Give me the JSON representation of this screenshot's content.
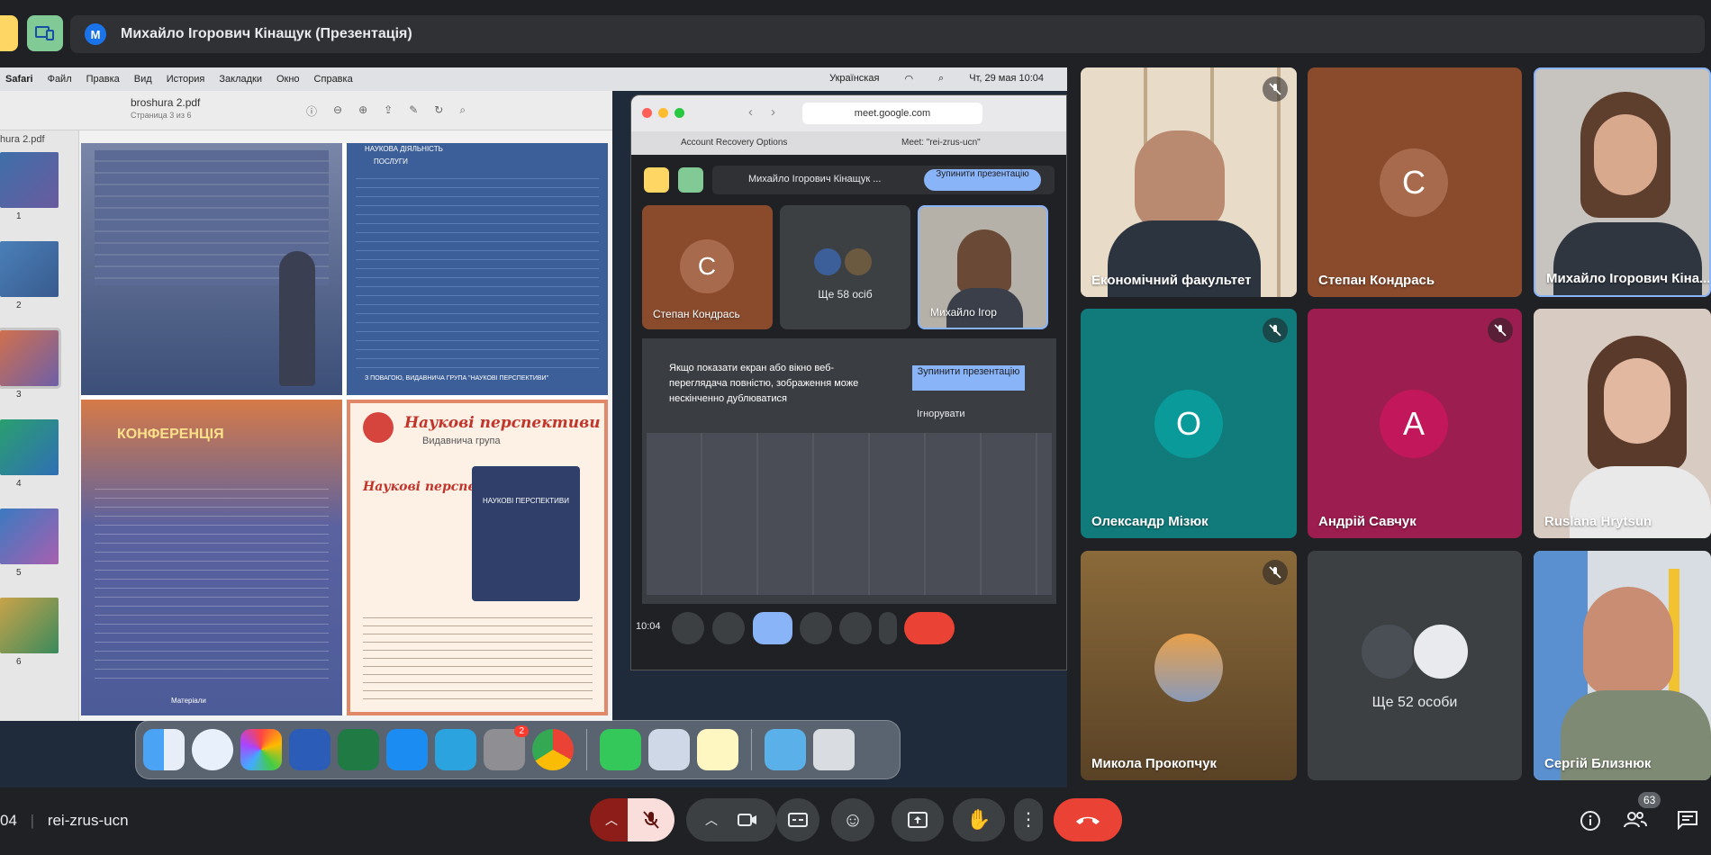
{
  "top": {
    "presenter_initial": "M",
    "presenter_title": "Михайло Ігорович Кінащук (Презентація)"
  },
  "mac": {
    "menu": [
      "Safari",
      "Файл",
      "Правка",
      "Вид",
      "История",
      "Закладки",
      "Окно",
      "Справка"
    ],
    "keyboard": "Українская",
    "datetime": "Чт, 29 мая  10:04"
  },
  "preview": {
    "file": "broshura 2.pdf",
    "page_info": "Страница 3 из 6",
    "side_file": "hura 2.pdf",
    "thumbs": [
      "1",
      "2",
      "3",
      "4",
      "5",
      "6"
    ],
    "page_title": "Наукові перспективи",
    "page_subtitle": "Видавнича група",
    "brochure_quote": "Наукові перспективи",
    "conf_title": "КОНФЕРЕНЦІЯ",
    "book_title": "НАУКОВІ ПЕРСПЕКТИВИ",
    "footer_text": "З ПОВАГОЮ, ВИДАВНИЧА ГРУПА \"НАУКОВІ ПЕРСПЕКТИВИ\"",
    "header_text": "НАУКОВА ДІЯЛЬНІСТЬ",
    "posluhy": "ПОСЛУГИ",
    "materials": "Матеріали"
  },
  "browser": {
    "url": "meet.google.com",
    "tab1": "Account Recovery Options",
    "tab2": "Meet: \"rei-zrus-ucn\"",
    "presenter": "Михайло Ігорович Кінащук ...",
    "stop_btn": "Зупинити презентацію",
    "tile1_initial": "С",
    "tile1_name": "Степан Кондрась",
    "tile2_more": "Ще 58 осіб",
    "tile3_name": "Михайло Ігор",
    "warning": "Якщо показати екран або вікно веб-переглядача повністю, зображення може нескінченно дублюватися",
    "warn_stop": "Зупинити презентацію",
    "warn_ignore": "Ігнорувати",
    "time": "10:04"
  },
  "dock": {
    "badge": "2"
  },
  "tiles": [
    {
      "name": "Економічний факультет"
    },
    {
      "name": "Степан Кондрась",
      "initial": "С"
    },
    {
      "name": "Михайло Ігорович Кіна..."
    },
    {
      "name": "Олександр Мізюк",
      "initial": "О"
    },
    {
      "name": "Андрій Савчук",
      "initial": "А"
    },
    {
      "name": "Ruslana Hrytsun"
    },
    {
      "name": "Микола Прокопчук"
    },
    {
      "more": "Ще 52 особи"
    },
    {
      "name": "Сергій Близнюк"
    }
  ],
  "bottom": {
    "time_fragment": "04",
    "meet_code": "rei-zrus-ucn",
    "participants_count": "63"
  },
  "colors": {
    "meet_bg": "#202124",
    "red": "#ea4335",
    "tile_brown": "#8a4b2d",
    "tile_teal": "#117a7a",
    "tile_magenta": "#9c1d4f",
    "accent_blue": "#8ab4f8"
  }
}
